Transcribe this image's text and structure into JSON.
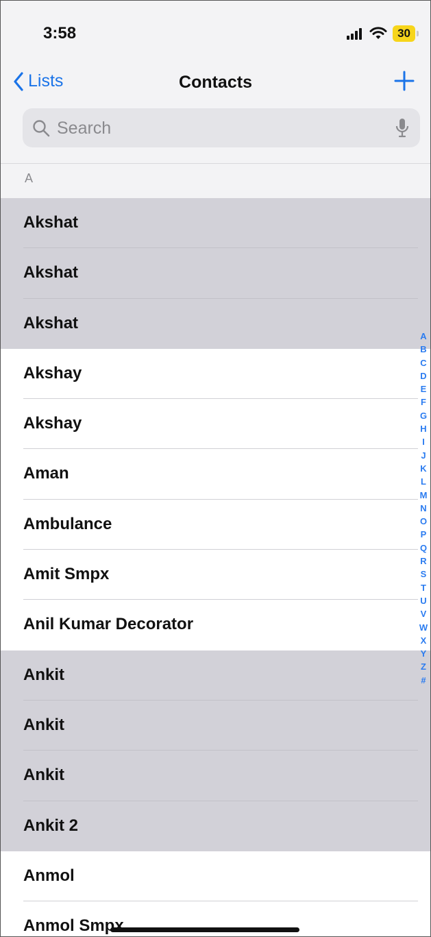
{
  "status_bar": {
    "time": "3:58",
    "battery": "30"
  },
  "nav": {
    "back_label": "Lists",
    "title": "Contacts"
  },
  "search": {
    "placeholder": "Search"
  },
  "section": {
    "header": "A"
  },
  "contacts": [
    {
      "name": "Akshat",
      "selected": true
    },
    {
      "name": "Akshat",
      "selected": true
    },
    {
      "name": "Akshat",
      "selected": true
    },
    {
      "name": "Akshay",
      "selected": false
    },
    {
      "name": "Akshay",
      "selected": false
    },
    {
      "name": "Aman",
      "selected": false
    },
    {
      "name": "Ambulance",
      "selected": false
    },
    {
      "name": "Amit Smpx",
      "selected": false
    },
    {
      "name": "Anil Kumar Decorator",
      "selected": false
    },
    {
      "name": "Ankit",
      "selected": true
    },
    {
      "name": "Ankit",
      "selected": true
    },
    {
      "name": "Ankit",
      "selected": true
    },
    {
      "name": "Ankit 2",
      "selected": true
    },
    {
      "name": "Anmol",
      "selected": false
    },
    {
      "name": "Anmol Smpx",
      "selected": false
    }
  ],
  "alphabet_index": [
    "A",
    "B",
    "C",
    "D",
    "E",
    "F",
    "G",
    "H",
    "I",
    "J",
    "K",
    "L",
    "M",
    "N",
    "O",
    "P",
    "Q",
    "R",
    "S",
    "T",
    "U",
    "V",
    "W",
    "X",
    "Y",
    "Z",
    "#"
  ],
  "colors": {
    "accent": "#1a73e8",
    "selected_row": "#d2d1d8",
    "battery": "#f7d51b"
  },
  "icons": {
    "back": "chevron-left-icon",
    "add": "plus-icon",
    "search": "magnifier-icon",
    "mic": "microphone-icon",
    "signal": "cellular-signal-icon",
    "wifi": "wifi-icon"
  }
}
